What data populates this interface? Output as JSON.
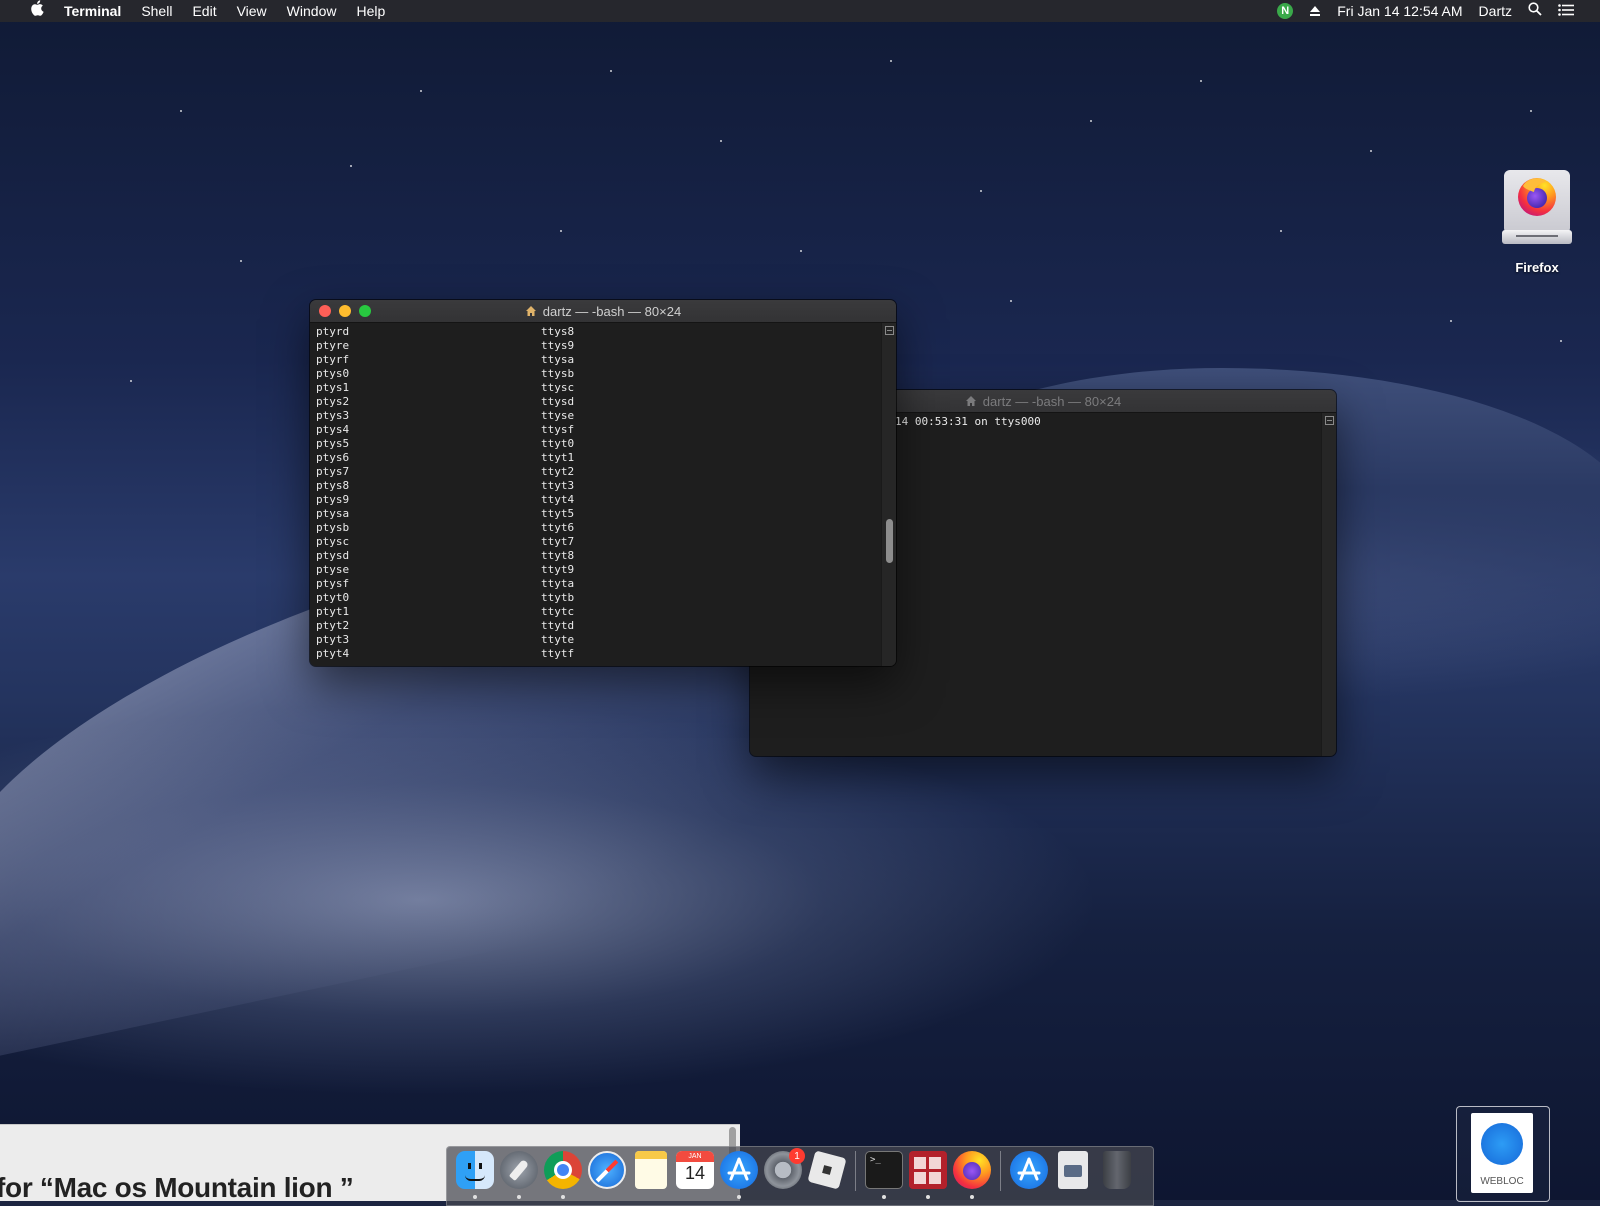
{
  "menubar": {
    "app_name": "Terminal",
    "menus": [
      "Shell",
      "Edit",
      "View",
      "Window",
      "Help"
    ],
    "status_badge": "N",
    "clock": "Fri Jan 14  12:54 AM",
    "user": "Dartz"
  },
  "front_terminal": {
    "title": "dartz — -bash — 80×24",
    "rows": [
      [
        "ptyrd",
        "ttys8"
      ],
      [
        "ptyre",
        "ttys9"
      ],
      [
        "ptyrf",
        "ttysa"
      ],
      [
        "ptys0",
        "ttysb"
      ],
      [
        "ptys1",
        "ttysc"
      ],
      [
        "ptys2",
        "ttysd"
      ],
      [
        "ptys3",
        "ttyse"
      ],
      [
        "ptys4",
        "ttysf"
      ],
      [
        "ptys5",
        "ttyt0"
      ],
      [
        "ptys6",
        "ttyt1"
      ],
      [
        "ptys7",
        "ttyt2"
      ],
      [
        "ptys8",
        "ttyt3"
      ],
      [
        "ptys9",
        "ttyt4"
      ],
      [
        "ptysa",
        "ttyt5"
      ],
      [
        "ptysb",
        "ttyt6"
      ],
      [
        "ptysc",
        "ttyt7"
      ],
      [
        "ptysd",
        "ttyt8"
      ],
      [
        "ptyse",
        "ttyt9"
      ],
      [
        "ptysf",
        "ttyta"
      ],
      [
        "ptyt0",
        "ttytb"
      ],
      [
        "ptyt1",
        "ttytc"
      ],
      [
        "ptyt2",
        "ttytd"
      ],
      [
        "ptyt3",
        "ttyte"
      ],
      [
        "ptyt4",
        "ttytf"
      ]
    ]
  },
  "back_terminal": {
    "title": "dartz — -bash — 80×24",
    "line1": "14 00:53:31 on ttys000"
  },
  "desktop": {
    "firefox_label": "Firefox",
    "webloc_label": "WEBLOC"
  },
  "background_window": {
    "search_text": "for “Mac os Mountain lion ”"
  },
  "dock": {
    "badge_count": "1",
    "calendar_month": "JAN",
    "calendar_day": "14"
  }
}
